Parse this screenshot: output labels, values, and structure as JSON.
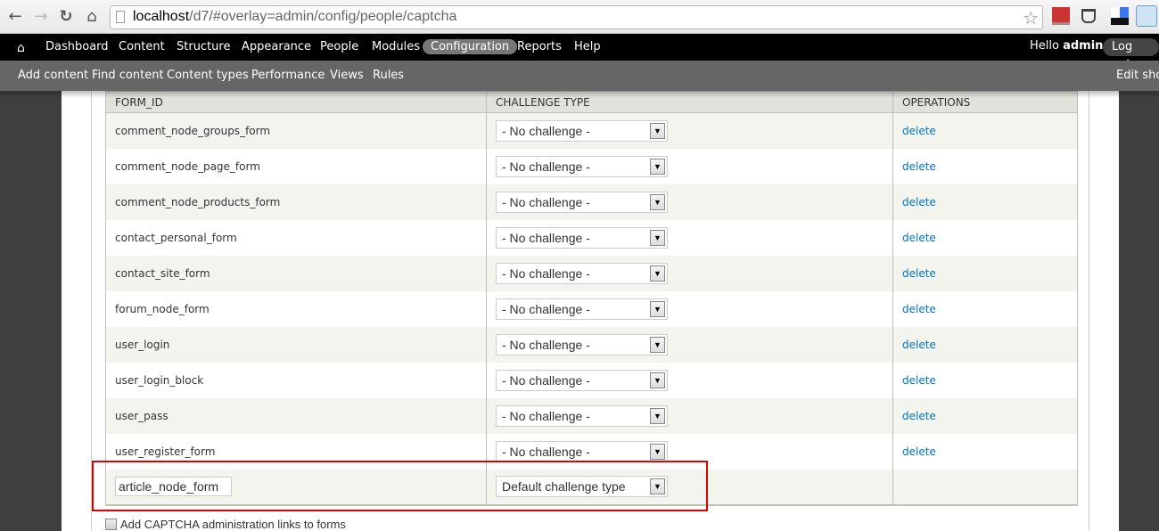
{
  "browser": {
    "url_host": "localhost",
    "url_path": "/d7/#overlay=admin/config/people/captcha",
    "back_icon": "back-arrow-icon",
    "forward_icon": "forward-arrow-icon",
    "reload_icon": "reload-icon",
    "home_icon": "home-icon",
    "bookmark_icon": "star-icon",
    "extensions": [
      "address-book-icon",
      "bucket-icon",
      "blocks-icon",
      "screen-capture-icon"
    ]
  },
  "toolbar": {
    "home_icon": "home-icon",
    "items": [
      "Dashboard",
      "Content",
      "Structure",
      "Appearance",
      "People",
      "Modules",
      "Configuration",
      "Reports",
      "Help"
    ],
    "active": "Configuration",
    "hello": "Hello",
    "user": "admin",
    "logout": "Log out"
  },
  "shortcuts": {
    "items": [
      "Add content",
      "Find content",
      "Content types",
      "Performance",
      "Views",
      "Rules"
    ],
    "edit": "Edit shortcuts"
  },
  "table": {
    "headers": [
      "FORM_ID",
      "CHALLENGE TYPE",
      "OPERATIONS"
    ],
    "rows": [
      {
        "form_id": "comment_node_groups_form",
        "challenge": "- No challenge -",
        "op": "delete"
      },
      {
        "form_id": "comment_node_page_form",
        "challenge": "- No challenge -",
        "op": "delete"
      },
      {
        "form_id": "comment_node_products_form",
        "challenge": "- No challenge -",
        "op": "delete"
      },
      {
        "form_id": "contact_personal_form",
        "challenge": "- No challenge -",
        "op": "delete"
      },
      {
        "form_id": "contact_site_form",
        "challenge": "- No challenge -",
        "op": "delete"
      },
      {
        "form_id": "forum_node_form",
        "challenge": "- No challenge -",
        "op": "delete"
      },
      {
        "form_id": "user_login",
        "challenge": "- No challenge -",
        "op": "delete"
      },
      {
        "form_id": "user_login_block",
        "challenge": "- No challenge -",
        "op": "delete"
      },
      {
        "form_id": "user_pass",
        "challenge": "- No challenge -",
        "op": "delete"
      },
      {
        "form_id": "user_register_form",
        "challenge": "- No challenge -",
        "op": "delete"
      }
    ],
    "new_row": {
      "form_id_value": "article_node_form",
      "challenge": "Default challenge type"
    }
  },
  "checkbox": {
    "label": "Add CAPTCHA administration links to forms",
    "checked": false
  },
  "colors": {
    "link": "#0074bd",
    "highlight": "#e00000",
    "toolbar": "#000000",
    "shortcuts": "#666666"
  }
}
